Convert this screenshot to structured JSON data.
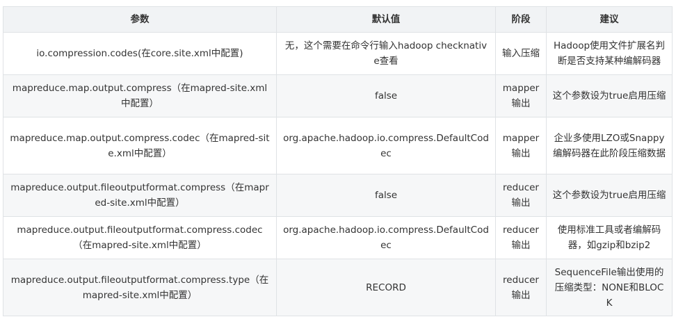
{
  "columns": [
    "参数",
    "默认值",
    "阶段",
    "建议"
  ],
  "rows": [
    {
      "param": "io.compression.codes(在core.site.xml中配置)",
      "default": "无，这个需要在命令行输入hadoop checknative查看",
      "stage": "输入压缩",
      "advice": "Hadoop使用文件扩展名判断是否支持某种编解码器"
    },
    {
      "param": "mapreduce.map.output.compress（在mapred-site.xml中配置）",
      "default": "false",
      "stage": "mapper输出",
      "advice": "这个参数设为true启用压缩"
    },
    {
      "param": "mapreduce.map.output.compress.codec（在mapred-site.xml中配置）",
      "default": "org.apache.hadoop.io.compress.DefaultCodec",
      "stage": "mapper输出",
      "advice": "企业多使用LZO或Snappy编解码器在此阶段压缩数据"
    },
    {
      "param": "mapreduce.output.fileoutputformat.compress（在mapred-site.xml中配置）",
      "default": "false",
      "stage": "reducer输出",
      "advice": "这个参数设为true启用压缩"
    },
    {
      "param": "mapreduce.output.fileoutputformat.compress.codec（在mapred-site.xml中配置）",
      "default": "org.apache.hadoop.io.compress.DefaultCodec",
      "stage": "reducer输出",
      "advice": "使用标准工具或者编解码器，如gzip和bzip2"
    },
    {
      "param": "mapreduce.output.fileoutputformat.compress.type（在mapred-site.xml中配置）",
      "default": "RECORD",
      "stage": "reducer输出",
      "advice": "SequenceFile输出使用的压缩类型：NONE和BLOCK"
    }
  ]
}
